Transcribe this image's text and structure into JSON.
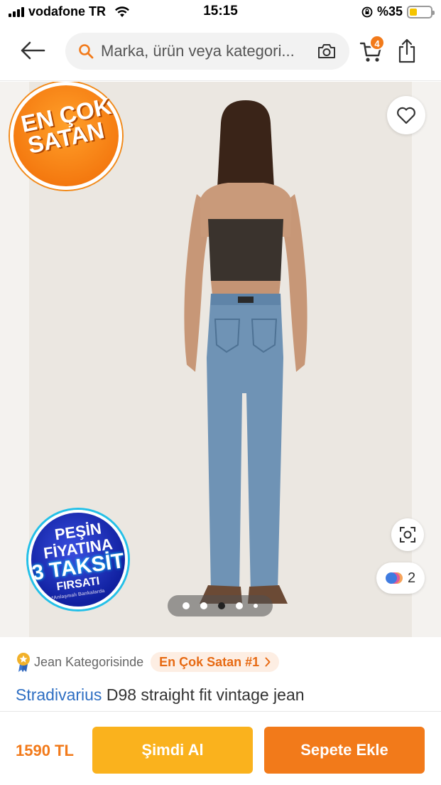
{
  "status_bar": {
    "carrier": "vodafone TR",
    "time": "15:15",
    "battery_text": "%35",
    "battery_level": 0.35
  },
  "header": {
    "search": {
      "placeholder": "Marka, ürün veya kategori..."
    },
    "cart_count": "4",
    "icons": [
      "back-arrow-icon",
      "search-icon",
      "camera-icon",
      "cart-icon",
      "share-icon"
    ]
  },
  "gallery": {
    "best_seller_badge": {
      "line1": "EN ÇOK",
      "line2": "SATAN"
    },
    "installment_badge": {
      "line1": "PEŞİN",
      "line2": "FİYATINA",
      "line3": "3 TAKSİT",
      "line4": "FIRSATI",
      "line5": "*Anlaşmalı Bankalarda"
    },
    "color_count": "2",
    "slides": 5,
    "active_slide": 3
  },
  "product": {
    "category_text": "Jean Kategorisinde",
    "rank_label": "En Çok Satan #1",
    "brand": "Stradivarius",
    "name": "D98 straight fit vintage jean"
  },
  "bottom_bar": {
    "price": "1590 TL",
    "buy_now_label": "Şimdi Al",
    "add_to_cart_label": "Sepete Ekle"
  },
  "colors": {
    "accent": "#f27a1a",
    "buy_now": "#fab21d",
    "brand_link": "#2f6fc3"
  }
}
